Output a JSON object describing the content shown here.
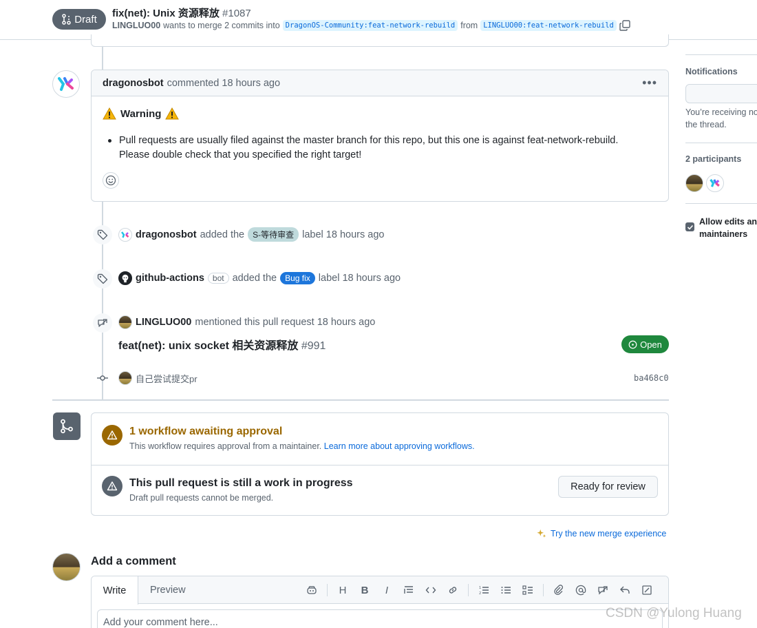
{
  "header": {
    "status_label": "Draft",
    "title": "fix(net): Unix 资源释放",
    "number": "#1087",
    "author": "LINGLUO00",
    "merge_text": "wants to merge 2 commits into",
    "base_branch": "DragonOS-Community:feat-network-rebuild",
    "from_text": "from",
    "head_branch": "LINGLUO00:feat-network-rebuild"
  },
  "comment": {
    "author": "dragonosbot",
    "meta": "commented 18 hours ago",
    "warning_title": "Warning",
    "bullet_line1": "Pull requests are usually filed against the master branch for this repo, but this one is against feat-network-rebuild.",
    "bullet_line2": "Please double check that you specified the right target!"
  },
  "events": {
    "e1": {
      "actor": "dragonosbot",
      "action": "added the",
      "label": "S-等待审查",
      "label_color": "#bfdadc",
      "suffix": "label 18 hours ago"
    },
    "e2": {
      "actor": "github-actions",
      "badge": "bot",
      "action": "added the",
      "label": "Bug fix",
      "label_color": "#1d76db",
      "suffix": "label 18 hours ago"
    },
    "e3": {
      "actor": "LINGLUO00",
      "action": "mentioned this pull request 18 hours ago",
      "ref_title": "feat(net): unix socket 相关资源释放",
      "ref_number": "#991",
      "ref_status": "Open"
    },
    "commit": {
      "message": "自己尝试提交pr",
      "sha": "ba468c0"
    }
  },
  "merge": {
    "workflow_title": "1 workflow awaiting approval",
    "workflow_desc": "This workflow requires approval from a maintainer.",
    "workflow_link": "Learn more about approving workflows.",
    "wip_title": "This pull request is still a work in progress",
    "wip_desc": "Draft pull requests cannot be merged.",
    "ready_button": "Ready for review",
    "try_merge": "Try the new merge experience"
  },
  "editor": {
    "heading": "Add a comment",
    "tab_write": "Write",
    "tab_preview": "Preview",
    "placeholder": "Add your comment here..."
  },
  "sidebar": {
    "notifications_heading": "Notifications",
    "notif_line1": "You’re receiving no",
    "notif_line2": "the thread.",
    "participants_heading": "2 participants",
    "allow_line1": "Allow edits an",
    "allow_line2": "maintainers"
  },
  "watermark": "CSDN @Yulong Huang",
  "colors": {
    "draft_gray": "#59636e",
    "open_green": "#1f883d",
    "link_blue": "#0969da",
    "attention": "#9a6700"
  }
}
